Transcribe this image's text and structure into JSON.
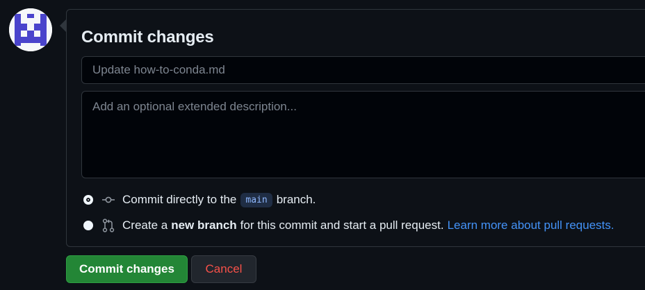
{
  "avatar": {
    "icon": "identicon-avatar",
    "color": "#4a44cc"
  },
  "commit_panel": {
    "title": "Commit changes",
    "summary_placeholder": "Update how-to-conda.md",
    "summary_value": "",
    "description_placeholder": "Add an optional extended description...",
    "description_value": "",
    "options": [
      {
        "icon": "git-commit-icon",
        "checked": true,
        "prefix": "Commit directly to the",
        "branch": "main",
        "suffix": "branch."
      },
      {
        "icon": "git-pull-request-icon",
        "checked": false,
        "prefix": "Create a",
        "bold": "new branch",
        "suffix": "for this commit and start a pull request.",
        "link": "Learn more about pull requests."
      }
    ]
  },
  "actions": {
    "commit_label": "Commit changes",
    "cancel_label": "Cancel"
  },
  "colors": {
    "background": "#0d1117",
    "border": "#30363d",
    "primary_button": "#238636",
    "danger_text": "#f85149",
    "link": "#4493f8"
  }
}
